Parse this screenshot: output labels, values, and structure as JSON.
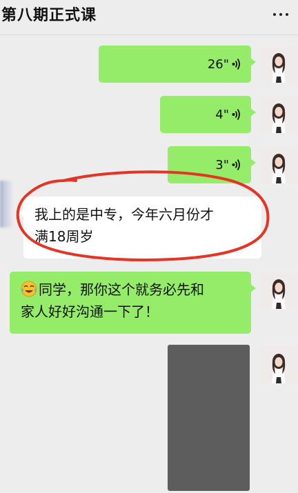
{
  "header": {
    "title": "第八期正式课",
    "more_icon": "more-dots-icon"
  },
  "messages": [
    {
      "type": "voice",
      "side": "right",
      "duration": "26\""
    },
    {
      "type": "voice",
      "side": "right",
      "duration": "4\""
    },
    {
      "type": "voice",
      "side": "right",
      "duration": "3\""
    },
    {
      "type": "text",
      "side": "left",
      "lines": [
        "我上的是中专，今年六月份才",
        "满18周岁"
      ]
    },
    {
      "type": "text",
      "side": "right",
      "emoji": "crying-laugh-emoji-icon",
      "lines": [
        "同学，那你这个就务必先和",
        "家人好好沟通一下了！"
      ]
    },
    {
      "type": "video",
      "side": "right"
    }
  ],
  "colors": {
    "background": "#ededed",
    "own_bubble": "#95ec69",
    "other_bubble": "#ffffff",
    "annotation": "#e53324",
    "video_placeholder": "#5d5d5d"
  }
}
